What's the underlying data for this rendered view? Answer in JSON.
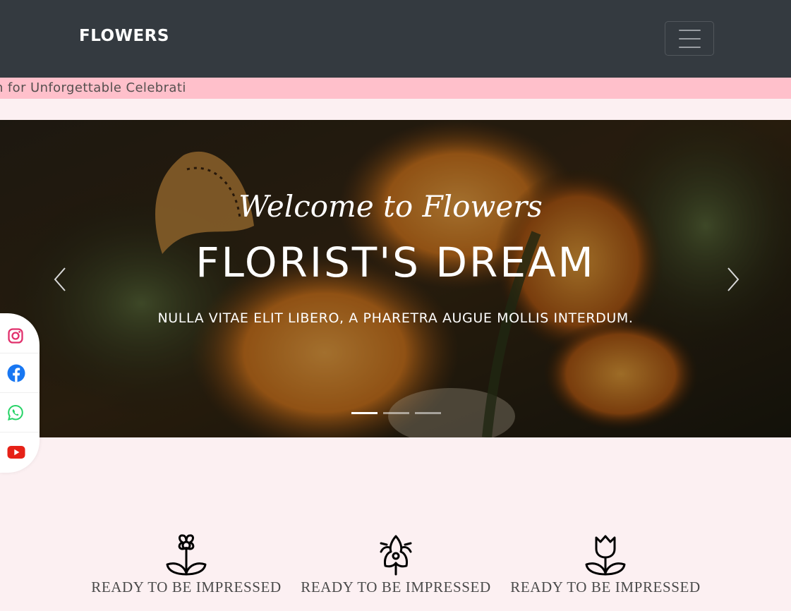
{
  "navbar": {
    "brand": "FLOWERS"
  },
  "ticker": {
    "text": "n for Unforgettable Celebrati"
  },
  "hero": {
    "script_title": "Welcome to Flowers",
    "title": "FLORIST'S DREAM",
    "subtitle": "NULLA VITAE ELIT LIBERO, A PHARETRA AUGUE MOLLIS INTERDUM.",
    "slide_count": 3,
    "active_slide": 1
  },
  "social": {
    "items": [
      "instagram-icon",
      "facebook-icon",
      "whatsapp-icon",
      "youtube-icon"
    ]
  },
  "features": [
    {
      "icon": "flower-icon",
      "label": "READY TO BE IMPRESSED"
    },
    {
      "icon": "lily-icon",
      "label": "READY TO BE IMPRESSED"
    },
    {
      "icon": "tulip-icon",
      "label": "READY TO BE IMPRESSED"
    }
  ],
  "colors": {
    "navbar": "#343a40",
    "ticker": "#ffc0cb",
    "page_background": "#fcf0f2",
    "instagram": "#e1306c",
    "facebook": "#1877f2",
    "whatsapp": "#25d366",
    "youtube": "#e62117"
  }
}
